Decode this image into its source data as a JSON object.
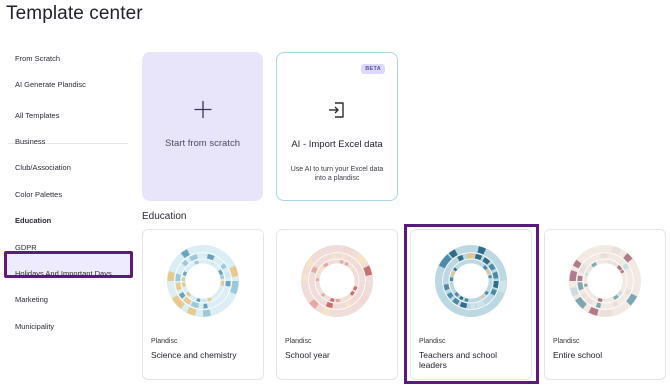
{
  "header": {
    "title": "Template center"
  },
  "sidebar": {
    "items": [
      {
        "label": "From Scratch"
      },
      {
        "label": "AI Generate Plandisc"
      },
      {
        "label": "All Templates"
      },
      {
        "label": "Business"
      },
      {
        "label": "Club/Association"
      },
      {
        "label": "Color Palettes"
      },
      {
        "label": "Education"
      },
      {
        "label": "GDPR"
      },
      {
        "label": "Holidays And Important Days"
      },
      {
        "label": "Marketing"
      },
      {
        "label": "Municipality"
      }
    ],
    "active": "Education"
  },
  "cards": {
    "scratch": {
      "label": "Start from scratch",
      "icon": "plus-icon"
    },
    "ai_import": {
      "badge": "BETA",
      "title": "AI - Import Excel data",
      "description": "Use AI to turn your Excel data into a plandisc",
      "icon": "import-icon"
    }
  },
  "section": {
    "title": "Education"
  },
  "templates": [
    {
      "brand": "Plandisc",
      "name": "Science and chemistry",
      "accent": "#7fb7cf"
    },
    {
      "brand": "Plandisc",
      "name": "School year",
      "accent": "#d98b8b"
    },
    {
      "brand": "Plandisc",
      "name": "Teachers and school leaders",
      "accent": "#4c8aa8"
    },
    {
      "brand": "Plandisc",
      "name": "Entire school",
      "accent": "#b07a8a"
    }
  ],
  "colors": {
    "accent": "#5c1a7c",
    "scratch_bg": "#e8e5fb"
  }
}
